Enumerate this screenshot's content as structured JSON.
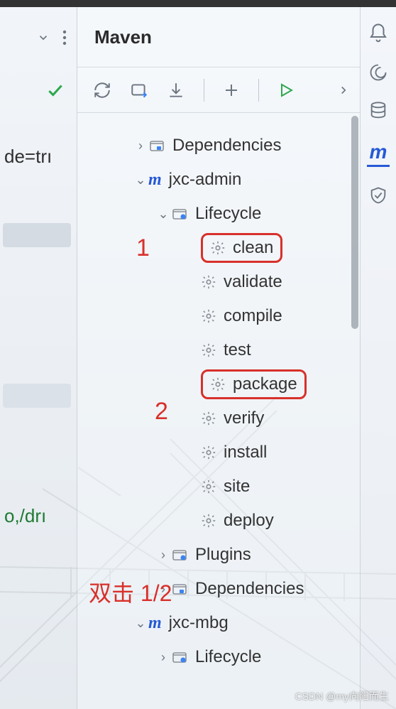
{
  "panel": {
    "title": "Maven"
  },
  "editor": {
    "frag1": "de=trı",
    "frag2": "o,/drı"
  },
  "tree": {
    "dependencies_root": "Dependencies",
    "jxc_admin": "jxc-admin",
    "lifecycle": "Lifecycle",
    "goals": {
      "clean": "clean",
      "validate": "validate",
      "compile": "compile",
      "test": "test",
      "package": "package",
      "verify": "verify",
      "install": "install",
      "site": "site",
      "deploy": "deploy"
    },
    "plugins": "Plugins",
    "dependencies": "Dependencies",
    "jxc_mbg": "jxc-mbg",
    "lifecycle2": "Lifecycle"
  },
  "annotations": {
    "one": "1",
    "two": "2",
    "doubleclick": "双击 1/2"
  },
  "watermark": "CSDN @my向阳而生"
}
